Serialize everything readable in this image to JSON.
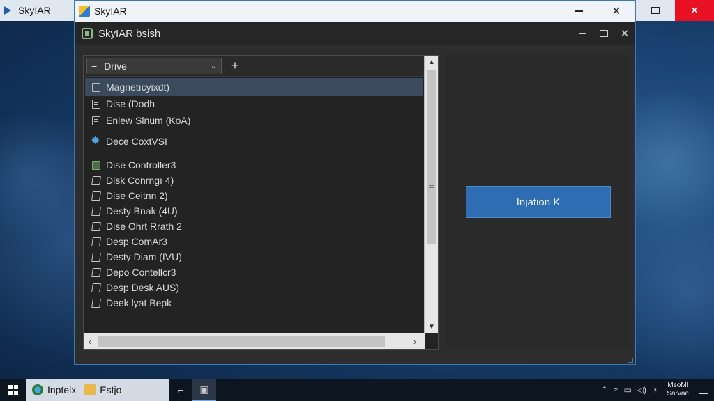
{
  "desktop": {
    "bg_window_title": "SkyIAR"
  },
  "outer_window": {
    "title": "SkyIAR"
  },
  "inner_window": {
    "title": "SkyIAR bsish"
  },
  "toolbar": {
    "drive_label": "Drive",
    "add_glyph": "+"
  },
  "list": {
    "items": [
      {
        "label": "Magnetıcyixdt)",
        "icon": "checkbox-icon",
        "selected": true
      },
      {
        "label": "Dise (Dodh",
        "icon": "document-icon"
      },
      {
        "label": "Enlew Slnum (KoA)",
        "icon": "document-icon"
      },
      {
        "label": "Dece CoxtVSI",
        "icon": "star-icon"
      },
      {
        "label": "Dise Controller3",
        "icon": "chip-icon"
      },
      {
        "label": "Disk Conrngı 4)",
        "icon": "edit-icon"
      },
      {
        "label": "Dise Ceitnn 2)",
        "icon": "edit-icon"
      },
      {
        "label": "Desty Bnak (4U)",
        "icon": "edit-icon"
      },
      {
        "label": "Dise Ohrt Rrath 2",
        "icon": "edit-icon"
      },
      {
        "label": "Desp ComAr3",
        "icon": "edit-icon"
      },
      {
        "label": "Desty Diam (IVU)",
        "icon": "edit-icon"
      },
      {
        "label": "Depo Contellcr3",
        "icon": "edit-icon"
      },
      {
        "label": "Desp Desk AUS)",
        "icon": "edit-icon"
      },
      {
        "label": "Deek lyat Bepk",
        "icon": "edit-icon"
      }
    ]
  },
  "right_pane": {
    "button_label": "Injation K"
  },
  "taskbar": {
    "app1_label": "Inptelx",
    "app2_label": "Estjo",
    "clock_line1": "MsoMl",
    "clock_line2": "Sarvae"
  }
}
